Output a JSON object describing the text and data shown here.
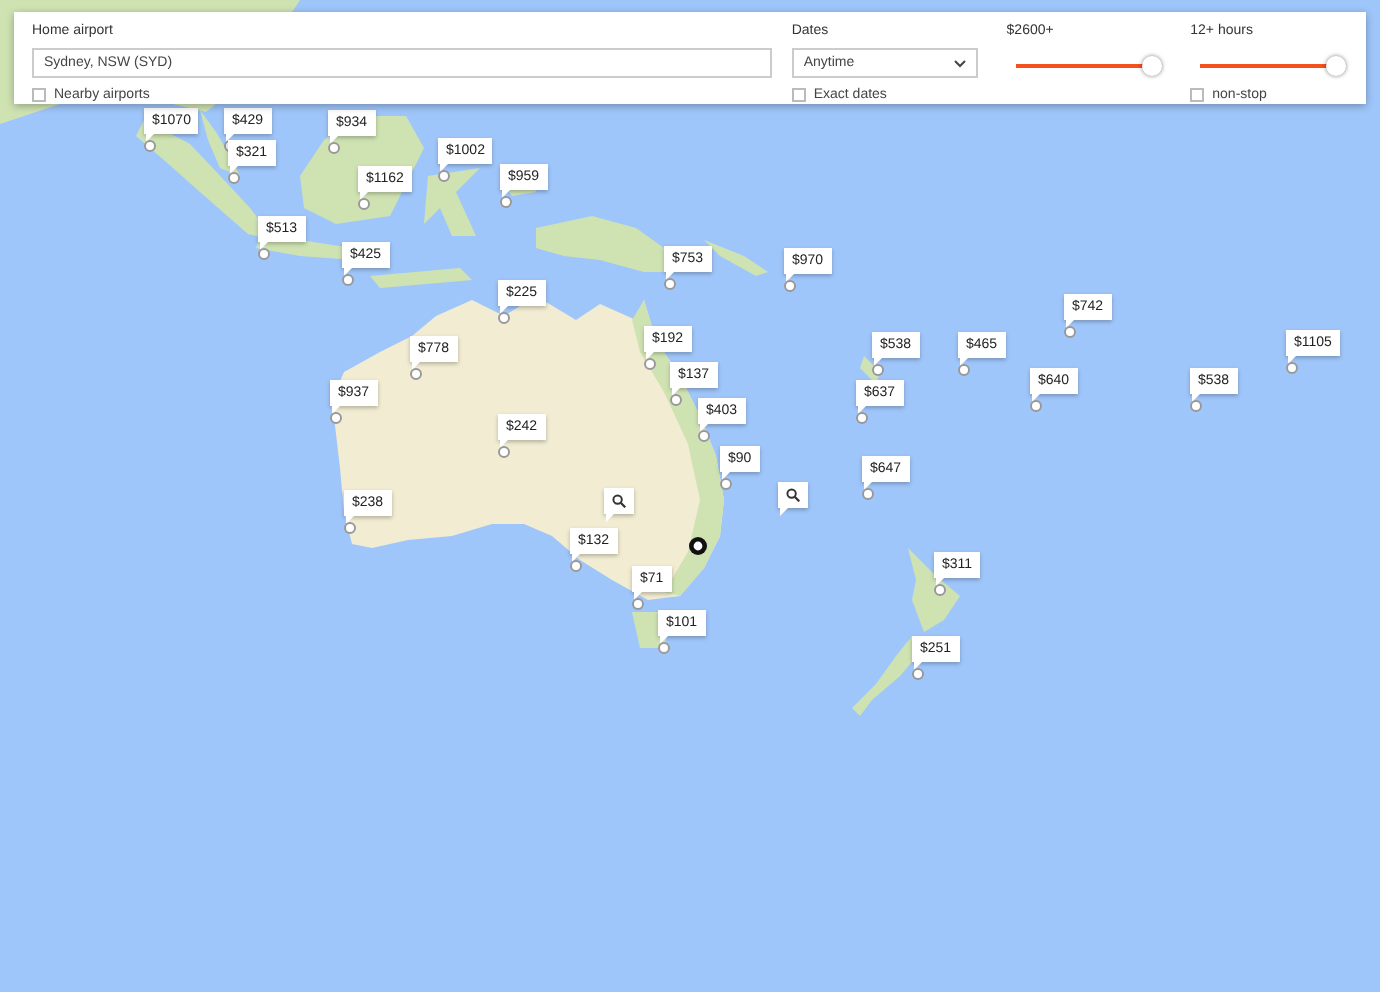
{
  "search_panel": {
    "home_airport": {
      "label": "Home airport",
      "value": "Sydney, NSW (SYD)"
    },
    "nearby_airports": {
      "label": "Nearby airports",
      "checked": false
    },
    "dates": {
      "label": "Dates",
      "value": "Anytime"
    },
    "exact_dates": {
      "label": "Exact dates",
      "checked": false
    },
    "price": {
      "label": "$2600+",
      "level": 1
    },
    "duration": {
      "label": "12+ hours",
      "level": 1
    },
    "non_stop": {
      "label": "non-stop",
      "checked": false
    }
  },
  "map": {
    "pins": [
      {
        "kind": "price",
        "price": "$1070"
      },
      {
        "kind": "price",
        "price": "$429"
      },
      {
        "kind": "price",
        "price": "$934"
      },
      {
        "kind": "price",
        "price": "$321"
      },
      {
        "kind": "price",
        "price": "$1002"
      },
      {
        "kind": "price",
        "price": "$1162"
      },
      {
        "kind": "price",
        "price": "$959"
      },
      {
        "kind": "price",
        "price": "$513"
      },
      {
        "kind": "price",
        "price": "$425"
      },
      {
        "kind": "price",
        "price": "$753"
      },
      {
        "kind": "price",
        "price": "$970"
      },
      {
        "kind": "price",
        "price": "$225"
      },
      {
        "kind": "price",
        "price": "$742"
      },
      {
        "kind": "price",
        "price": "$192"
      },
      {
        "kind": "price",
        "price": "$538"
      },
      {
        "kind": "price",
        "price": "$465"
      },
      {
        "kind": "price",
        "price": "$1105"
      },
      {
        "kind": "price",
        "price": "$778"
      },
      {
        "kind": "price",
        "price": "$137"
      },
      {
        "kind": "price",
        "price": "$640"
      },
      {
        "kind": "price",
        "price": "$538"
      },
      {
        "kind": "price",
        "price": "$937"
      },
      {
        "kind": "price",
        "price": "$637"
      },
      {
        "kind": "price",
        "price": "$403"
      },
      {
        "kind": "price",
        "price": "$242"
      },
      {
        "kind": "price",
        "price": "$90"
      },
      {
        "kind": "price",
        "price": "$647"
      },
      {
        "kind": "search"
      },
      {
        "kind": "search"
      },
      {
        "kind": "price",
        "price": "$238"
      },
      {
        "kind": "price",
        "price": "$132"
      },
      {
        "kind": "price",
        "price": "$311"
      },
      {
        "kind": "price",
        "price": "$71"
      },
      {
        "kind": "price",
        "price": "$101"
      },
      {
        "kind": "price",
        "price": "$251"
      }
    ]
  }
}
